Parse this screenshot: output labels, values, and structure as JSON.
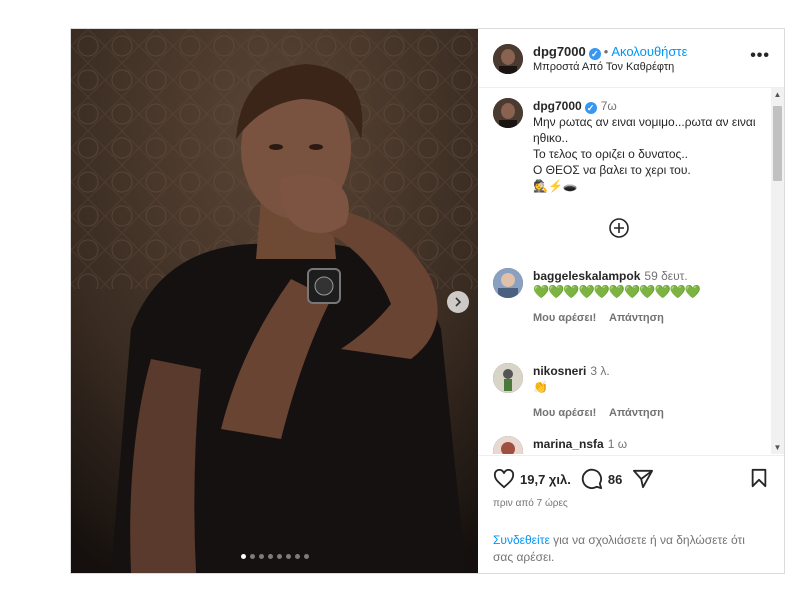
{
  "post": {
    "author": "dpg7000",
    "follow_label": "Ακολουθήστε",
    "separator": "•",
    "location": "Μπροστά Από Τον Καθρέφτη",
    "more_label": "•••"
  },
  "caption": {
    "username": "dpg7000",
    "time": "7ω",
    "lines": [
      "Μην ρωτας αν ειναι νομιμο...ρωτα αν ειναι ηθικο..",
      "Το τελος το οριζει ο δυνατος..",
      "Ο ΘΕΟΣ να βαλει το χερι του.",
      "🕵️⚡🕳️"
    ]
  },
  "comments": [
    {
      "username": "baggeleskalampok",
      "time": "59 δευτ.",
      "text": "💚💚💚💚💚💚💚💚💚💚💚",
      "like": "Μου αρέσει!",
      "reply": "Απάντηση"
    },
    {
      "username": "nikosneri",
      "time": "3 λ.",
      "text": "👏",
      "like": "Μου αρέσει!",
      "reply": "Απάντηση"
    },
    {
      "username": "marina_nsfa",
      "time": "1 ω",
      "text": "",
      "like": "",
      "reply": ""
    }
  ],
  "stats": {
    "likes": "19,7 χιλ.",
    "comments": "86",
    "posted_ago": "πριν από 7 ώρες"
  },
  "login_prompt": {
    "link": "Συνδεθείτε",
    "rest": " για να σχολιάσετε ή να δηλώσετε ότι σας αρέσει."
  },
  "carousel": {
    "total": 8,
    "active": 0
  },
  "colors": {
    "accent": "#0095f6",
    "verified": "#3897f0",
    "heart_green": "#2ecc40"
  }
}
